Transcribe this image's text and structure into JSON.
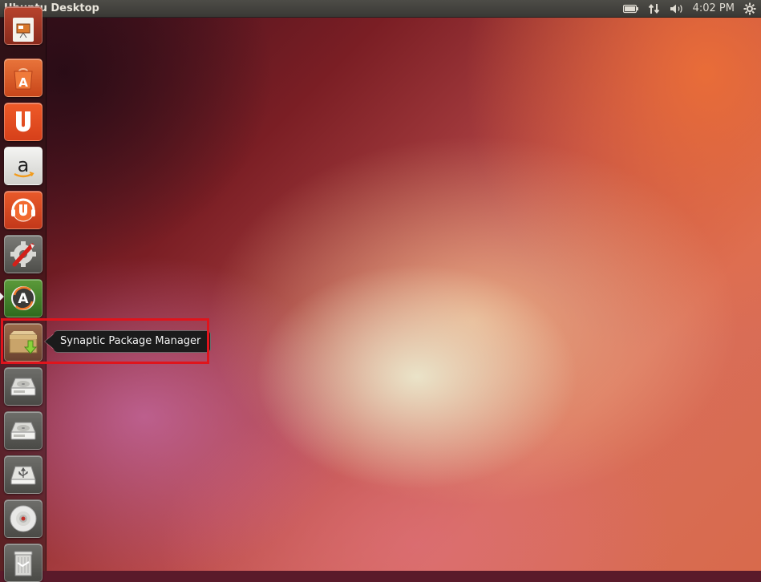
{
  "top_panel": {
    "title": "Ubuntu Desktop",
    "clock": "4:02 PM",
    "indicators": [
      "battery-icon",
      "network-icon",
      "volume-icon",
      "gear-icon"
    ]
  },
  "launcher": {
    "items": [
      {
        "name": "LibreOffice Impress",
        "icon": "presentation-icon"
      },
      {
        "name": "Ubuntu Software Center",
        "icon": "software-center-icon"
      },
      {
        "name": "Ubuntu One",
        "icon": "ubuntu-one-icon"
      },
      {
        "name": "Amazon",
        "icon": "amazon-icon"
      },
      {
        "name": "Ubuntu One Music",
        "icon": "ubuntu-one-music-icon"
      },
      {
        "name": "System Settings",
        "icon": "system-settings-icon"
      },
      {
        "name": "Software Updater",
        "icon": "software-updater-icon"
      },
      {
        "name": "Synaptic Package Manager",
        "icon": "synaptic-icon"
      },
      {
        "name": "Hard Disk",
        "icon": "hard-disk-icon"
      },
      {
        "name": "Hard Disk",
        "icon": "hard-disk-icon"
      },
      {
        "name": "USB Drive",
        "icon": "usb-drive-icon"
      },
      {
        "name": "CD Drive",
        "icon": "cd-icon"
      },
      {
        "name": "Trash",
        "icon": "trash-icon"
      }
    ]
  },
  "tooltip": {
    "text": "Synaptic Package Manager"
  },
  "colors": {
    "highlight": "#e0141c",
    "panel": "#3a3935",
    "tooltip_bg": "#1b1b1b"
  }
}
